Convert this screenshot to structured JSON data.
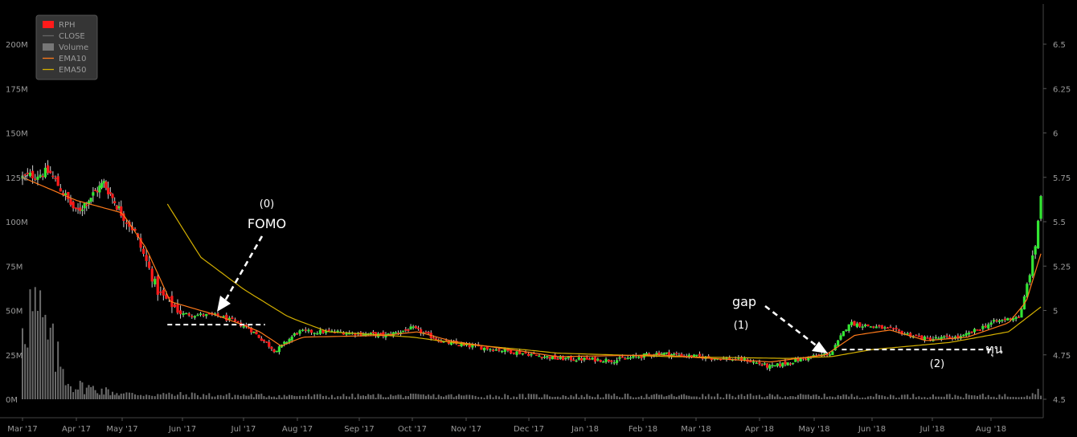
{
  "chart_data": {
    "type": "candlestick",
    "symbol": "RPH",
    "legend": [
      {
        "label": "RPH",
        "color": "#ff1a1a",
        "kind": "box"
      },
      {
        "label": "CLOSE",
        "color": "#666666",
        "kind": "line"
      },
      {
        "label": "Volume",
        "color": "#777777",
        "kind": "box"
      },
      {
        "label": "EMA10",
        "color": "#ff7a1a",
        "kind": "line"
      },
      {
        "label": "EMA50",
        "color": "#d4b000",
        "kind": "line"
      }
    ],
    "x_ticks": [
      "Mar '17",
      "Apr '17",
      "May '17",
      "Jun '17",
      "Jul '17",
      "Aug '17",
      "Sep '17",
      "Oct '17",
      "Nov '17",
      "Dec '17",
      "Jan '18",
      "Feb '18",
      "Mar '18",
      "Apr '18",
      "May '18",
      "Jun '18",
      "Jul '18",
      "Aug '18"
    ],
    "y_price_ticks": [
      "6.5",
      "6.25",
      "6",
      "5.75",
      "5.5",
      "5.25",
      "5",
      "4.75",
      "4.5"
    ],
    "y_volume_ticks": [
      "200M",
      "175M",
      "150M",
      "125M",
      "100M",
      "75M",
      "50M",
      "25M",
      "0M"
    ],
    "price_range": [
      4.45,
      6.7
    ],
    "volume_range": [
      0,
      225
    ],
    "price_keypoints": [
      {
        "month": 0.0,
        "close": 5.75
      },
      {
        "month": 0.5,
        "close": 5.78
      },
      {
        "month": 1.0,
        "close": 5.55
      },
      {
        "month": 1.6,
        "close": 5.72
      },
      {
        "month": 2.2,
        "close": 5.45
      },
      {
        "month": 2.6,
        "close": 5.1
      },
      {
        "month": 3.0,
        "close": 4.98
      },
      {
        "month": 3.6,
        "close": 4.97
      },
      {
        "month": 4.1,
        "close": 4.9
      },
      {
        "month": 4.6,
        "close": 4.77
      },
      {
        "month": 5.0,
        "close": 4.88
      },
      {
        "month": 5.6,
        "close": 4.88
      },
      {
        "month": 6.5,
        "close": 4.86
      },
      {
        "month": 7.0,
        "close": 4.9
      },
      {
        "month": 7.6,
        "close": 4.82
      },
      {
        "month": 8.5,
        "close": 4.78
      },
      {
        "month": 9.5,
        "close": 4.73
      },
      {
        "month": 10.5,
        "close": 4.72
      },
      {
        "month": 11.3,
        "close": 4.76
      },
      {
        "month": 12.0,
        "close": 4.74
      },
      {
        "month": 12.8,
        "close": 4.72
      },
      {
        "month": 13.2,
        "close": 4.68
      },
      {
        "month": 13.8,
        "close": 4.73
      },
      {
        "month": 14.3,
        "close": 4.76
      },
      {
        "month": 14.6,
        "close": 4.93
      },
      {
        "month": 15.2,
        "close": 4.9
      },
      {
        "month": 15.9,
        "close": 4.84
      },
      {
        "month": 16.5,
        "close": 4.85
      },
      {
        "month": 17.0,
        "close": 4.93
      },
      {
        "month": 17.5,
        "close": 4.97
      },
      {
        "month": 17.75,
        "close": 5.35
      },
      {
        "month": 17.85,
        "close": 5.65
      }
    ],
    "ema10_keypoints": [
      {
        "month": 0.0,
        "value": 5.75
      },
      {
        "month": 1.0,
        "value": 5.62
      },
      {
        "month": 2.0,
        "value": 5.55
      },
      {
        "month": 2.4,
        "value": 5.35
      },
      {
        "month": 2.8,
        "value": 5.05
      },
      {
        "month": 3.5,
        "value": 4.98
      },
      {
        "month": 4.3,
        "value": 4.88
      },
      {
        "month": 4.7,
        "value": 4.8
      },
      {
        "month": 5.1,
        "value": 4.85
      },
      {
        "month": 6.5,
        "value": 4.86
      },
      {
        "month": 7.1,
        "value": 4.88
      },
      {
        "month": 7.7,
        "value": 4.83
      },
      {
        "month": 9.5,
        "value": 4.74
      },
      {
        "month": 11.3,
        "value": 4.75
      },
      {
        "month": 13.2,
        "value": 4.71
      },
      {
        "month": 14.2,
        "value": 4.75
      },
      {
        "month": 14.7,
        "value": 4.86
      },
      {
        "month": 15.3,
        "value": 4.89
      },
      {
        "month": 15.9,
        "value": 4.83
      },
      {
        "month": 16.6,
        "value": 4.85
      },
      {
        "month": 17.3,
        "value": 4.93
      },
      {
        "month": 17.6,
        "value": 5.05
      },
      {
        "month": 17.85,
        "value": 5.32
      }
    ],
    "ema50_keypoints": [
      {
        "month": 2.75,
        "value": 5.6
      },
      {
        "month": 3.3,
        "value": 5.3
      },
      {
        "month": 4.0,
        "value": 5.12
      },
      {
        "month": 4.8,
        "value": 4.97
      },
      {
        "month": 5.5,
        "value": 4.88
      },
      {
        "month": 7.0,
        "value": 4.85
      },
      {
        "month": 8.0,
        "value": 4.81
      },
      {
        "month": 9.5,
        "value": 4.76
      },
      {
        "month": 11.5,
        "value": 4.74
      },
      {
        "month": 13.5,
        "value": 4.73
      },
      {
        "month": 14.3,
        "value": 4.74
      },
      {
        "month": 15.0,
        "value": 4.78
      },
      {
        "month": 16.3,
        "value": 4.82
      },
      {
        "month": 17.3,
        "value": 4.88
      },
      {
        "month": 17.85,
        "value": 5.02
      }
    ],
    "volume_keypoints": [
      {
        "month": 0.0,
        "value": 55
      },
      {
        "month": 0.3,
        "value": 45
      },
      {
        "month": 0.6,
        "value": 25
      },
      {
        "month": 0.9,
        "value": 8
      },
      {
        "month": 2.0,
        "value": 3
      },
      {
        "month": 4.5,
        "value": 2
      },
      {
        "month": 17.5,
        "value": 2
      },
      {
        "month": 17.85,
        "value": 5
      }
    ],
    "annotations": [
      {
        "label_top": "(0)",
        "label_bottom": "FOMO",
        "support_level": 4.92,
        "from_month": 2.75,
        "to_month": 5.1
      },
      {
        "label_top": "gap",
        "label_bottom": "(1)",
        "support_level": 4.78,
        "from_month": 14.2,
        "to_month": 17.2
      },
      {
        "label_top": "ทุน",
        "label_bottom": "(2)"
      }
    ]
  }
}
